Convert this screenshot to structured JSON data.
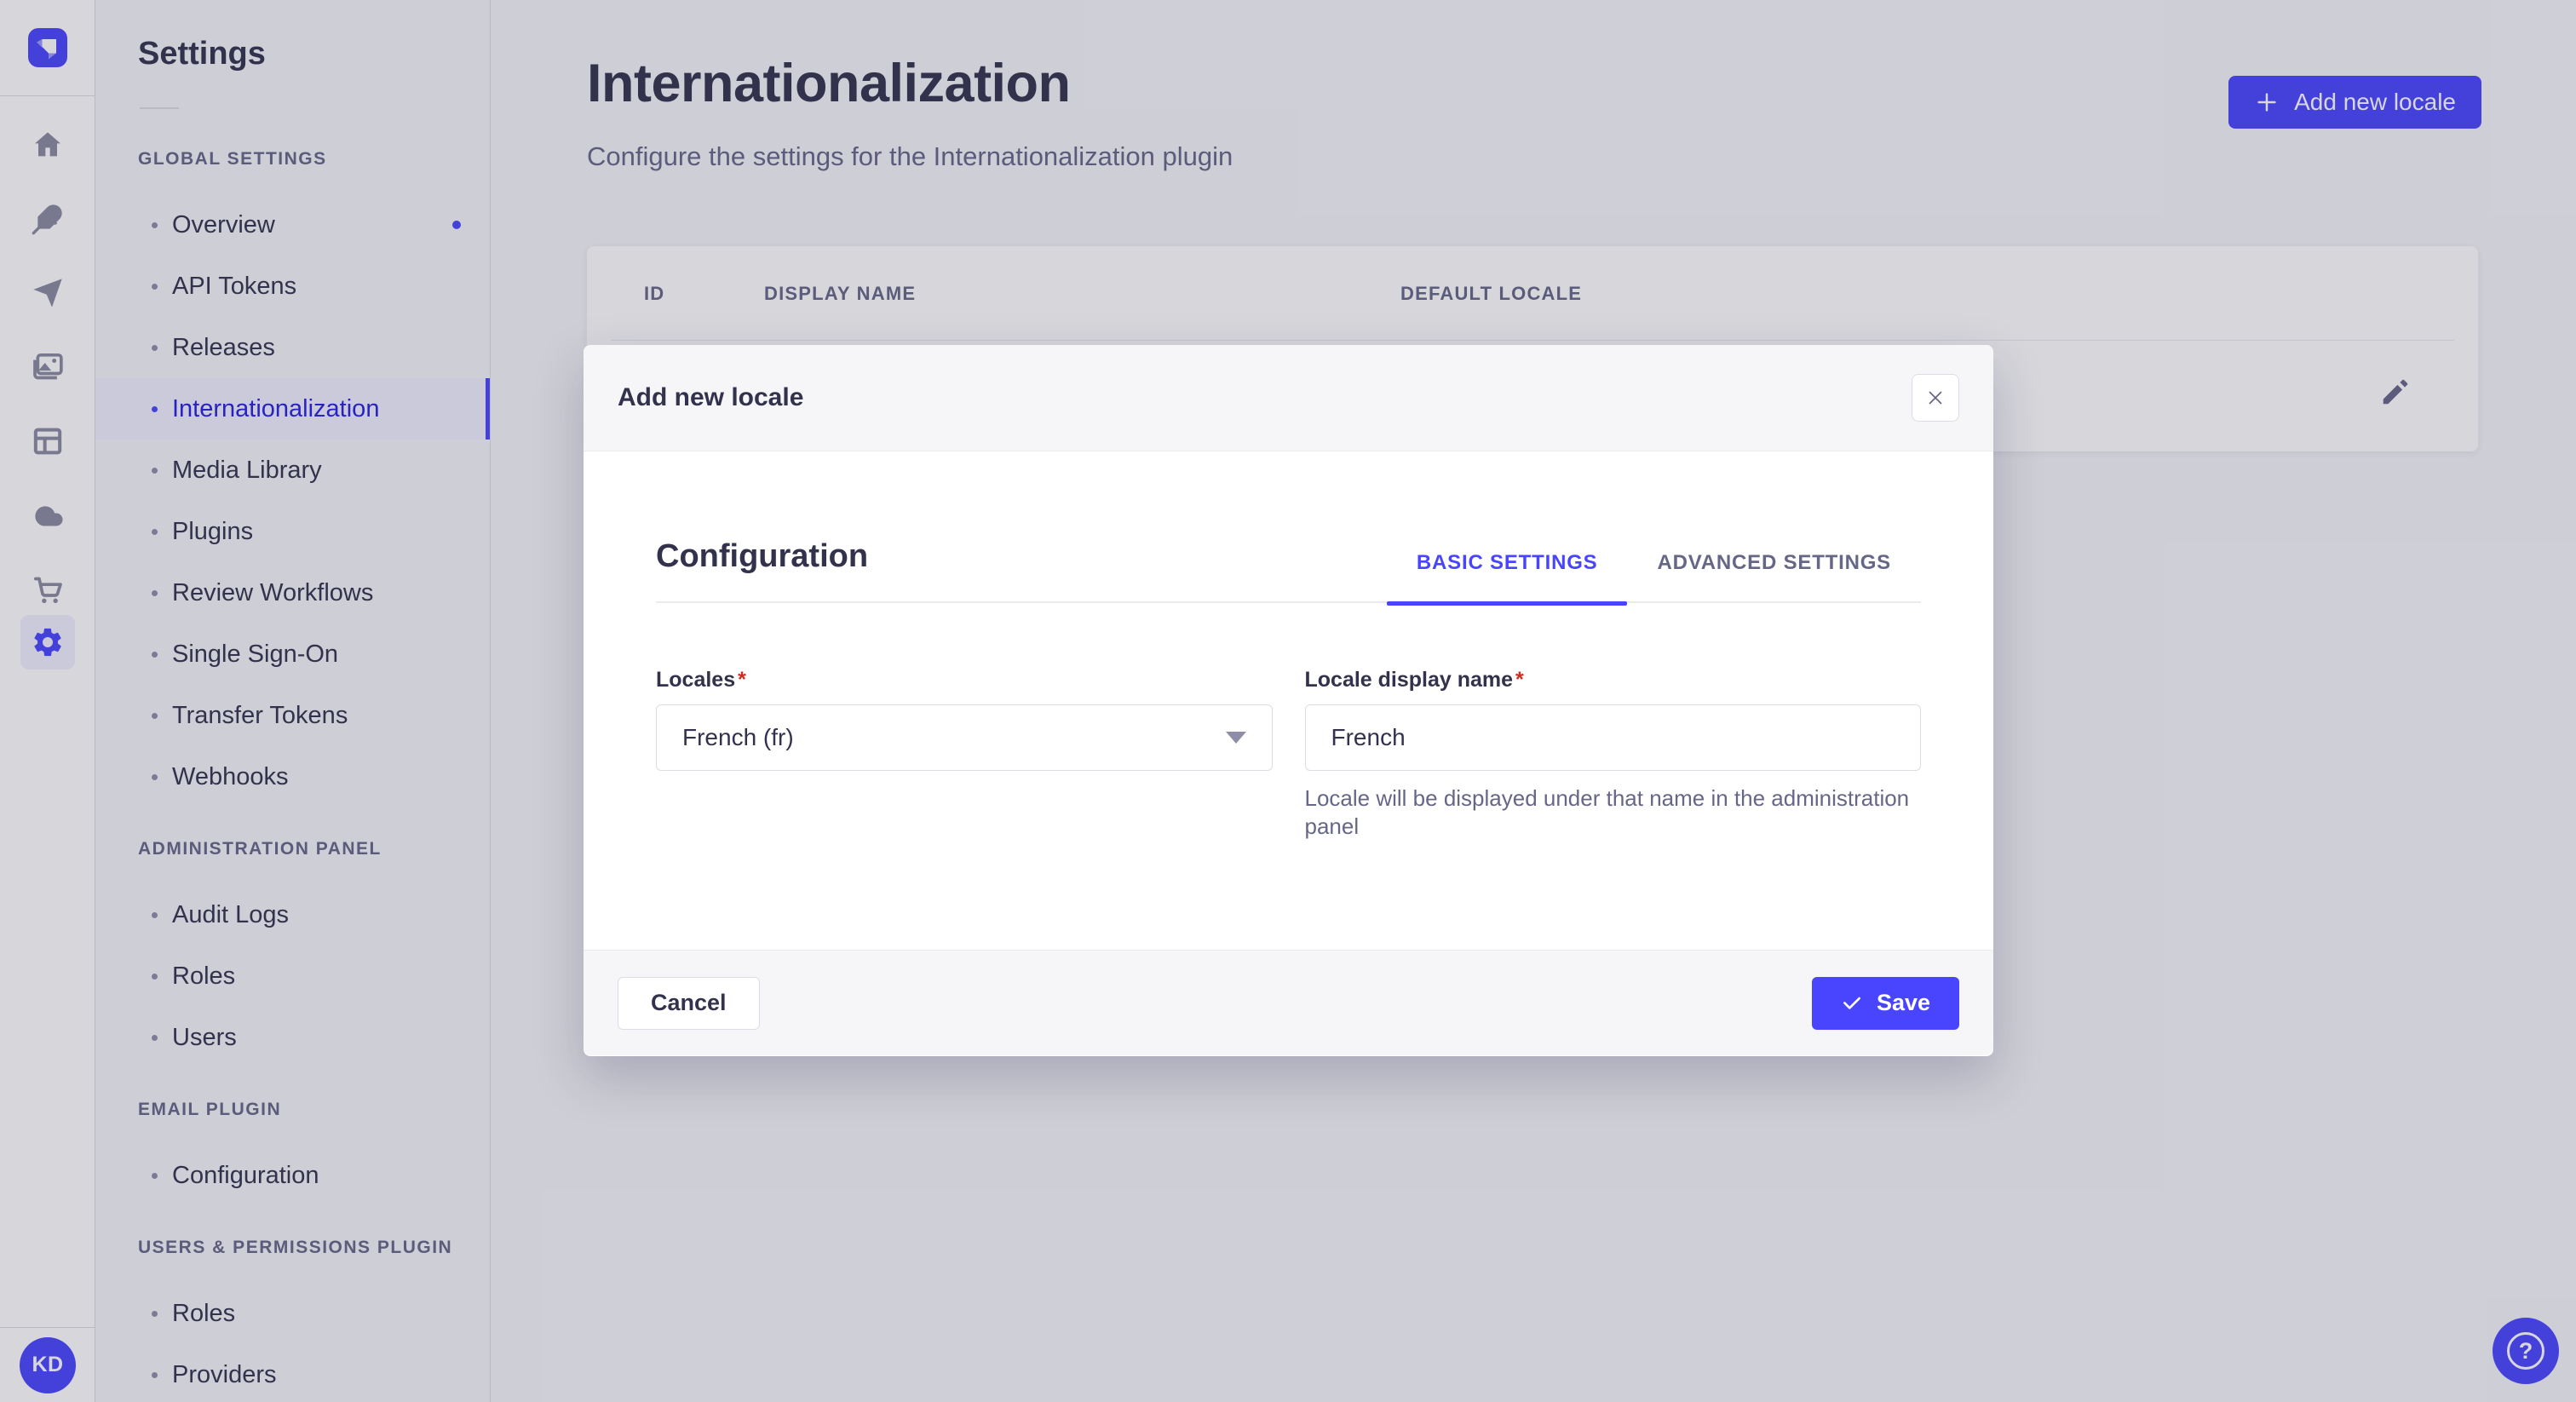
{
  "colors": {
    "primary": "#4945ff",
    "primary_dark": "#271fe0",
    "text_dark": "#32324d",
    "text_muted": "#666687",
    "required": "#d02b20"
  },
  "rail": {
    "icons": [
      "strapi-logo",
      "home-icon",
      "feather-icon",
      "paper-plane-icon",
      "media-icon",
      "layout-icon",
      "cloud-icon",
      "cart-icon",
      "gear-icon"
    ],
    "active_icon": "gear-icon",
    "avatar_initials": "KD"
  },
  "sidebar": {
    "title": "Settings",
    "sections": [
      {
        "label": "GLOBAL SETTINGS",
        "items": [
          {
            "label": "Overview",
            "active": false,
            "dot": true
          },
          {
            "label": "API Tokens"
          },
          {
            "label": "Releases"
          },
          {
            "label": "Internationalization",
            "active": true
          },
          {
            "label": "Media Library"
          },
          {
            "label": "Plugins"
          },
          {
            "label": "Review Workflows"
          },
          {
            "label": "Single Sign-On"
          },
          {
            "label": "Transfer Tokens"
          },
          {
            "label": "Webhooks"
          }
        ]
      },
      {
        "label": "ADMINISTRATION PANEL",
        "items": [
          {
            "label": "Audit Logs"
          },
          {
            "label": "Roles"
          },
          {
            "label": "Users"
          }
        ]
      },
      {
        "label": "EMAIL PLUGIN",
        "items": [
          {
            "label": "Configuration"
          }
        ]
      },
      {
        "label": "USERS & PERMISSIONS PLUGIN",
        "items": [
          {
            "label": "Roles"
          },
          {
            "label": "Providers"
          }
        ]
      }
    ]
  },
  "main": {
    "title": "Internationalization",
    "subtitle": "Configure the settings for the Internationalization plugin",
    "add_button_label": "Add new locale",
    "table": {
      "columns": [
        "ID",
        "DISPLAY NAME",
        "DEFAULT LOCALE"
      ]
    }
  },
  "modal": {
    "title": "Add new locale",
    "section_title": "Configuration",
    "tabs": [
      {
        "label": "BASIC SETTINGS",
        "active": true
      },
      {
        "label": "ADVANCED SETTINGS",
        "active": false
      }
    ],
    "required_marker": "*",
    "fields": {
      "locales": {
        "label": "Locales",
        "value": "French (fr)"
      },
      "display_name": {
        "label": "Locale display name",
        "value": "French",
        "helper": "Locale will be displayed under that name in the administration panel"
      }
    },
    "cancel_label": "Cancel",
    "save_label": "Save"
  },
  "fab": {
    "question_mark": "?"
  }
}
